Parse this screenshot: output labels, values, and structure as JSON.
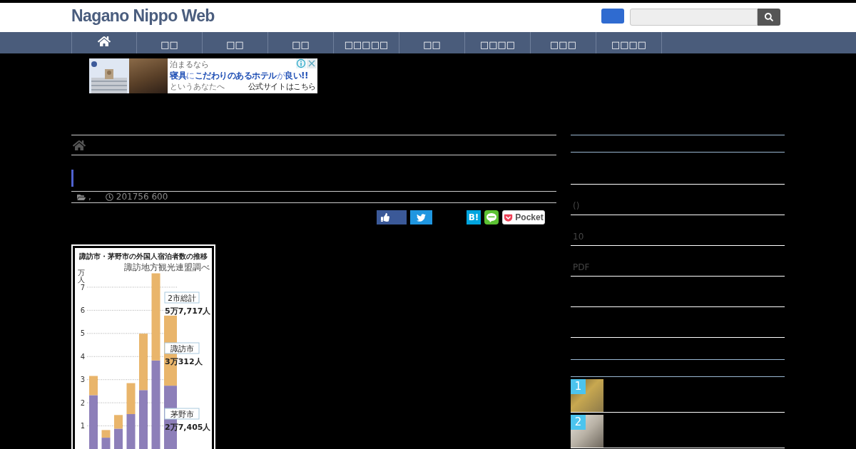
{
  "header": {
    "logo": "Nagano Nippo Web"
  },
  "nav": [
    {
      "kind": "home"
    },
    {
      "kind": "link",
      "label": "□□"
    },
    {
      "kind": "link",
      "label": "□□"
    },
    {
      "kind": "link",
      "label": "□□"
    },
    {
      "kind": "link",
      "label": "□□□□□"
    },
    {
      "kind": "link",
      "label": "□□"
    },
    {
      "kind": "link",
      "label": "□□□□"
    },
    {
      "kind": "link",
      "label": "□□□"
    },
    {
      "kind": "link",
      "label": "□□□□"
    }
  ],
  "ad_banner": {
    "lead": "泊まるなら",
    "headline": "**寝具**に**こだわりのあるホテル**が**良い!!**",
    "tagline": "というあなたへ",
    "link": "公式サイトはこちら"
  },
  "article": {
    "meta": {
      "category": ",",
      "date": "201756 600"
    },
    "share": [
      {
        "kind": "like"
      },
      {
        "kind": "tweet"
      },
      {
        "kind": "hatena",
        "label": "B!"
      },
      {
        "kind": "line"
      },
      {
        "kind": "pocket",
        "label": "Pocket"
      }
    ],
    "figure": {
      "source_note": "諏訪地方観光連盟調べ",
      "chart_data": {
        "type": "bar",
        "stacked": true,
        "grid": true,
        "title": "諏訪市・茅野市の外国人宿泊者数の推移",
        "ylabel": "万人",
        "ylim": [
          0,
          7.6
        ],
        "yticks": [
          1,
          2,
          3,
          4,
          5,
          6,
          7
        ],
        "series": [
          {
            "name": "茅野市",
            "color": "#8d7fb9",
            "values": [
              2.33,
              0.49,
              0.88,
              1.51,
              2.55,
              3.83,
              2.74
            ]
          },
          {
            "name": "諏訪市",
            "color": "#e9b56b",
            "values": [
              0.83,
              0.33,
              0.59,
              1.34,
              2.44,
              3.77,
              3.03
            ]
          }
        ],
        "annotations": [
          {
            "text": "2市総計"
          },
          {
            "text": "5万7,717人"
          },
          {
            "text": "3万312人"
          },
          {
            "text": "2万7,405人"
          }
        ]
      }
    }
  },
  "sidebar": {
    "widgets": [
      {
        "kind": "list",
        "items": [
          {
            "kind": "blank"
          },
          {
            "kind": "link",
            "label": "()"
          },
          {
            "kind": "link",
            "label": "10"
          },
          {
            "kind": "link",
            "label": "PDF"
          },
          {
            "kind": "blank"
          },
          {
            "kind": "blank"
          }
        ]
      },
      {
        "kind": "ranking",
        "items": [
          {
            "rank": "1"
          },
          {
            "rank": "2"
          }
        ]
      }
    ]
  }
}
